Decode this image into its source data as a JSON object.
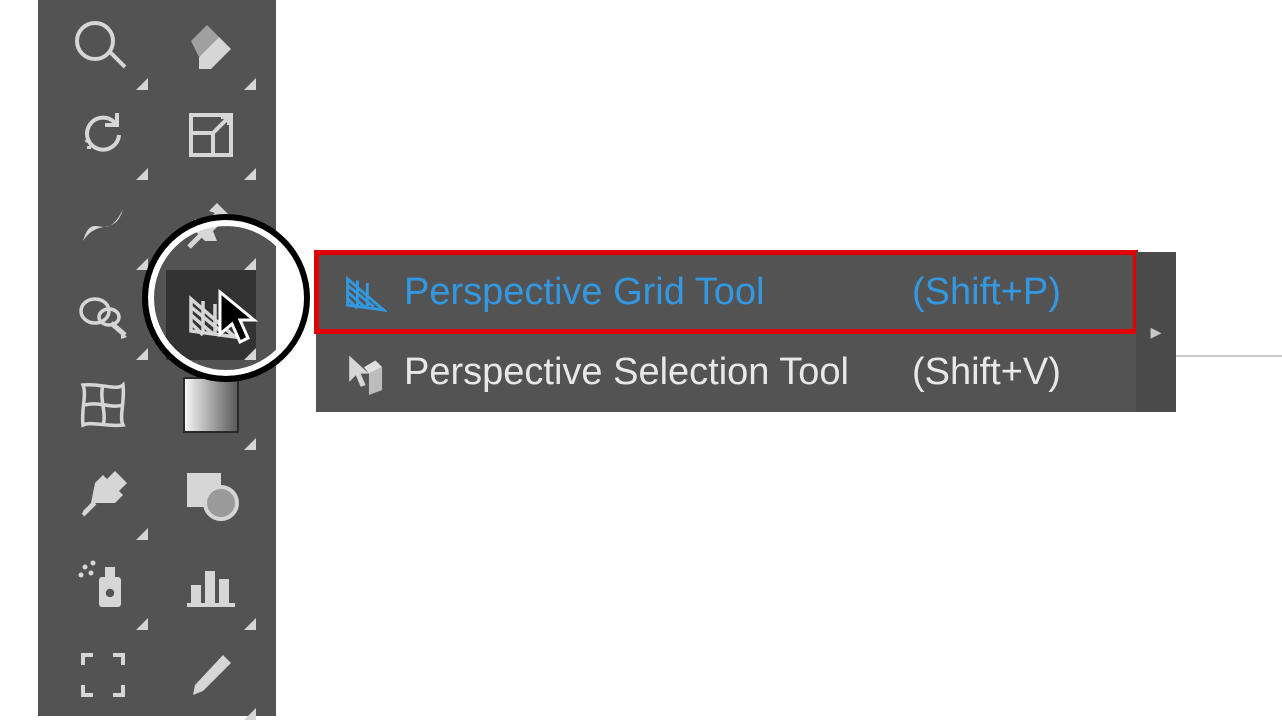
{
  "toolbar": {
    "row1": {
      "left_icon": "blob-brush",
      "right_icon": "eraser"
    },
    "row2": {
      "left_icon": "rotate",
      "right_icon": "scale"
    },
    "row3": {
      "left_icon": "width",
      "right_icon": "puppet-warp"
    },
    "row4": {
      "left_icon": "symbol-sprayer",
      "right_icon": "perspective-grid"
    },
    "row5": {
      "left_icon": "mesh",
      "right_icon": "gradient"
    },
    "row6": {
      "left_icon": "eyedropper",
      "right_icon": "blend"
    },
    "row7": {
      "left_icon": "symbol-sprayer-can",
      "right_icon": "column-graph"
    },
    "row8": {
      "left_icon": "artboard",
      "right_icon": "slice"
    }
  },
  "flyout": {
    "items": [
      {
        "icon": "perspective-grid",
        "label": "Perspective Grid Tool",
        "shortcut": "(Shift+P)",
        "selected": true,
        "highlighted": true
      },
      {
        "icon": "perspective-selection",
        "label": "Perspective Selection Tool",
        "shortcut": "(Shift+V)",
        "selected": false,
        "highlighted": false
      }
    ],
    "tearoff_glyph": "▸"
  }
}
